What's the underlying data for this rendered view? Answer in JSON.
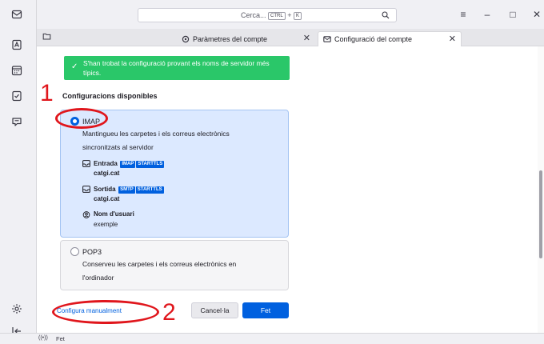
{
  "search": {
    "placeholder": "Cerca...",
    "shortcut_key1": "CTRL",
    "shortcut_plus": "+",
    "shortcut_key2": "K"
  },
  "tabs": [
    {
      "label": "Paràmetres del compte"
    },
    {
      "label": "Configuració del compte"
    }
  ],
  "notice": {
    "text": "S'han trobat la configuració provant els noms de servidor més típics."
  },
  "section_title": "Configuracions disponibles",
  "imap": {
    "label": "IMAP",
    "description": "Mantingueu les carpetes i els correus electrònics sincronitzats al servidor",
    "incoming_label": "Entrada",
    "incoming_protocol": "IMAP",
    "incoming_security": "STARTTLS",
    "incoming_host": "catgi.cat",
    "outgoing_label": "Sortida",
    "outgoing_protocol": "SMTP",
    "outgoing_security": "STARTTLS",
    "outgoing_host": "catgi.cat",
    "username_label": "Nom d'usuari",
    "username_value": "exemple",
    "selected": true
  },
  "pop3": {
    "label": "POP3",
    "description": "Conserveu les carpetes i els correus electrònics en l'ordinador",
    "selected": false
  },
  "actions": {
    "manual_link": "Configura manualment",
    "cancel": "Cancel·la",
    "done": "Fet"
  },
  "annotations": {
    "one": "1",
    "two": "2"
  },
  "status": {
    "text": "Fet"
  },
  "colors": {
    "accent": "#0060df",
    "success": "#2ac769",
    "annotation": "#e0161c"
  }
}
